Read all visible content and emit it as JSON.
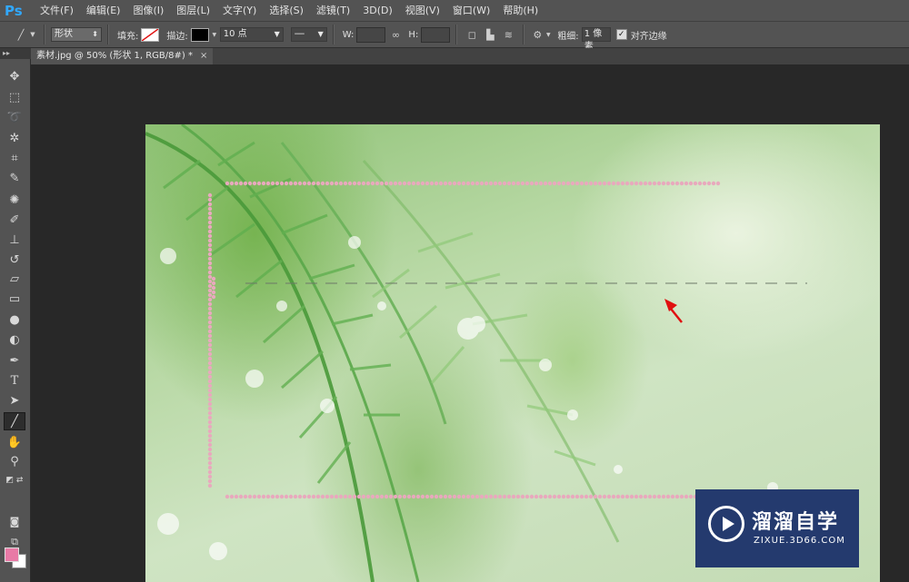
{
  "app": {
    "logo": "Ps"
  },
  "menu": [
    "文件(F)",
    "编辑(E)",
    "图像(I)",
    "图层(L)",
    "文字(Y)",
    "选择(S)",
    "滤镜(T)",
    "3D(D)",
    "视图(V)",
    "窗口(W)",
    "帮助(H)"
  ],
  "options": {
    "tool_mode": "形状",
    "fill_label": "填充:",
    "stroke_label": "描边:",
    "stroke_size": "10 点",
    "width_label": "W:",
    "height_label": "H:",
    "weight_label": "粗细:",
    "weight_value": "1 像素",
    "align_edges_label": "对齐边缘",
    "align_edges_checked": true
  },
  "document": {
    "tab_title": "素材.jpg @ 50% (形状 1, RGB/8#) *",
    "close_glyph": "×"
  },
  "tools": [
    "move-tool",
    "marquee-tool",
    "lasso-tool",
    "magic-wand-tool",
    "crop-tool",
    "eyedropper-tool",
    "spot-healing-tool",
    "brush-tool",
    "clone-stamp-tool",
    "history-brush-tool",
    "eraser-tool",
    "gradient-tool",
    "blur-tool",
    "dodge-tool",
    "pen-tool",
    "type-tool",
    "path-selection-tool",
    "line-tool",
    "hand-tool",
    "zoom-tool"
  ],
  "colors": {
    "foreground": "#e87aa6",
    "background": "#ffffff",
    "dots": "#e8a9bd",
    "arrow": "#e01010"
  },
  "watermark": {
    "title": "溜溜自学",
    "subtitle": "ZIXUE.3D66.COM"
  }
}
